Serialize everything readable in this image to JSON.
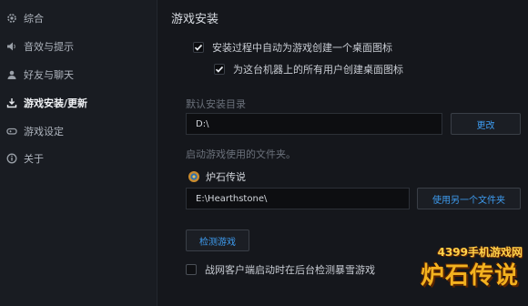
{
  "sidebar": {
    "items": [
      {
        "label": "综合",
        "icon": "gear-icon"
      },
      {
        "label": "音效与提示",
        "icon": "speaker-icon"
      },
      {
        "label": "好友与聊天",
        "icon": "friends-icon"
      },
      {
        "label": "游戏安装/更新",
        "icon": "install-icon",
        "active": true
      },
      {
        "label": "游戏设定",
        "icon": "gamepad-icon"
      },
      {
        "label": "关于",
        "icon": "info-icon"
      }
    ]
  },
  "main": {
    "title": "游戏安装",
    "checkbox_desktop_icon": {
      "label": "安装过程中自动为游戏创建一个桌面图标",
      "checked": true
    },
    "checkbox_all_users": {
      "label": "为这台机器上的所有用户创建桌面图标",
      "checked": true
    },
    "default_dir_label": "默认安装目录",
    "default_dir_value": "D:\\",
    "change_button": "更改",
    "folder_label": "启动游戏使用的文件夹。",
    "game_name": "炉石传说",
    "game_path_value": "E:\\Hearthstone\\",
    "use_other_folder_button": "使用另一个文件夹",
    "detect_games_button": "检测游戏",
    "checkbox_detect_startup": {
      "label": "战网客户端启动时在后台检测暴雪游戏",
      "checked": false
    }
  },
  "watermark": {
    "top_text": "4399手机游戏网",
    "main_text": "炉石传说"
  },
  "colors": {
    "accent": "#3e9cf0",
    "background": "#15171c",
    "sidebar_bg": "#191c22"
  }
}
